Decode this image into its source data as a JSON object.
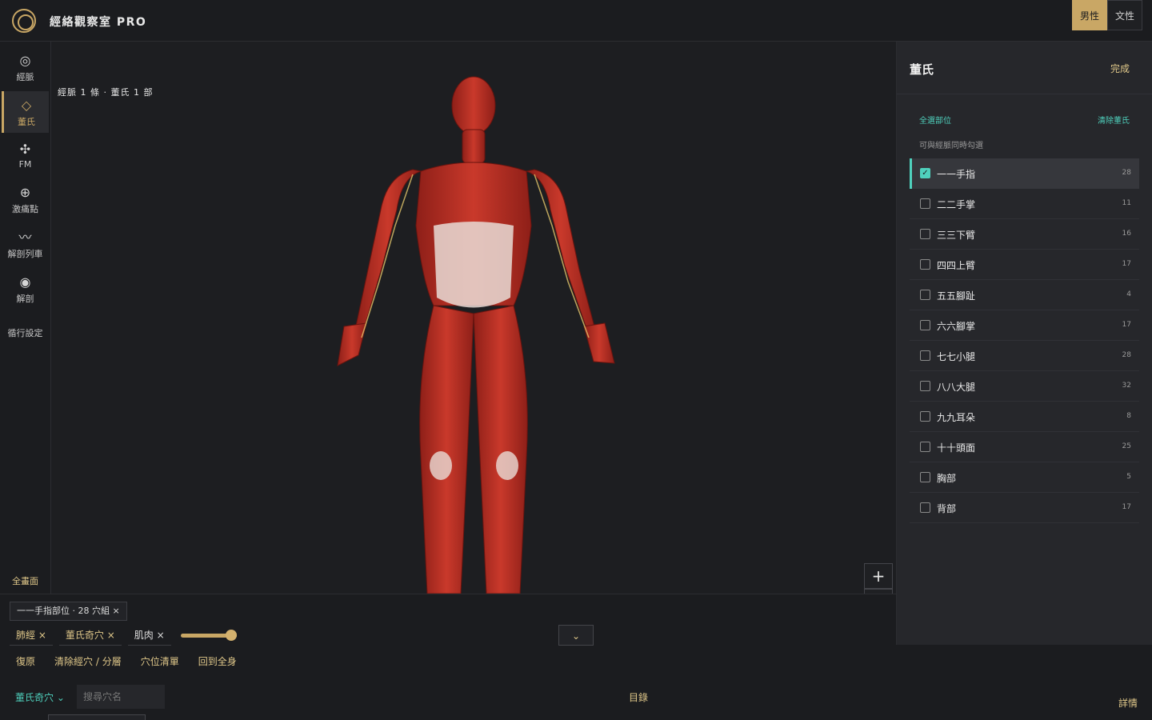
{
  "header": {
    "app_title": "經絡觀察室 PRO",
    "gender_male": "男性",
    "gender_female": "文性"
  },
  "leftnav": {
    "items": [
      {
        "label": "經脈",
        "icon": "ring-icon"
      },
      {
        "label": "董氏",
        "icon": "diamond-icon"
      },
      {
        "label": "FM",
        "icon": "nodes-icon"
      },
      {
        "label": "激痛點",
        "icon": "plus-circle-icon"
      },
      {
        "label": "解剖列車",
        "icon": "wave-icon"
      },
      {
        "label": "解剖",
        "icon": "dot-circle-icon"
      }
    ],
    "settings": "循行設定",
    "fullscreen": "全畫面"
  },
  "viewport": {
    "status": "經脈 1 條 · 董氏 1 部",
    "zoom": "+"
  },
  "panel": {
    "title": "董氏",
    "done": "完成",
    "select_all": "全選部位",
    "clear": "清除董氏",
    "hint": "可與經脈同時勾選",
    "rows": [
      {
        "name": "一一手指",
        "count": "28",
        "checked": true
      },
      {
        "name": "二二手掌",
        "count": "11",
        "checked": false
      },
      {
        "name": "三三下臂",
        "count": "16",
        "checked": false
      },
      {
        "name": "四四上臂",
        "count": "17",
        "checked": false
      },
      {
        "name": "五五腳趾",
        "count": "4",
        "checked": false
      },
      {
        "name": "六六腳掌",
        "count": "17",
        "checked": false
      },
      {
        "name": "七七小腿",
        "count": "28",
        "checked": false
      },
      {
        "name": "八八大腿",
        "count": "32",
        "checked": false
      },
      {
        "name": "九九耳朵",
        "count": "8",
        "checked": false
      },
      {
        "name": "十十頭面",
        "count": "25",
        "checked": false
      },
      {
        "name": "胸部",
        "count": "5",
        "checked": false
      },
      {
        "name": "背部",
        "count": "17",
        "checked": false
      }
    ]
  },
  "bottom": {
    "chip_main": "一一手指部位 · 28 穴組 ×",
    "chips": [
      "肺經 ×",
      "董氏奇穴 ×",
      "肌肉 ×"
    ],
    "opacity": 0.8,
    "actions": [
      "復原",
      "清除經穴 / 分層",
      "穴位清單",
      "回到全身"
    ],
    "collapse": "⌄",
    "filter": "董氏奇穴",
    "search_placeholder": "搜尋穴名",
    "catalog": "目錄",
    "details": "詳情"
  },
  "colors": {
    "accent_gold": "#c9a765",
    "accent_teal": "#4fd1bd",
    "muscle_red": "#c0392b"
  }
}
